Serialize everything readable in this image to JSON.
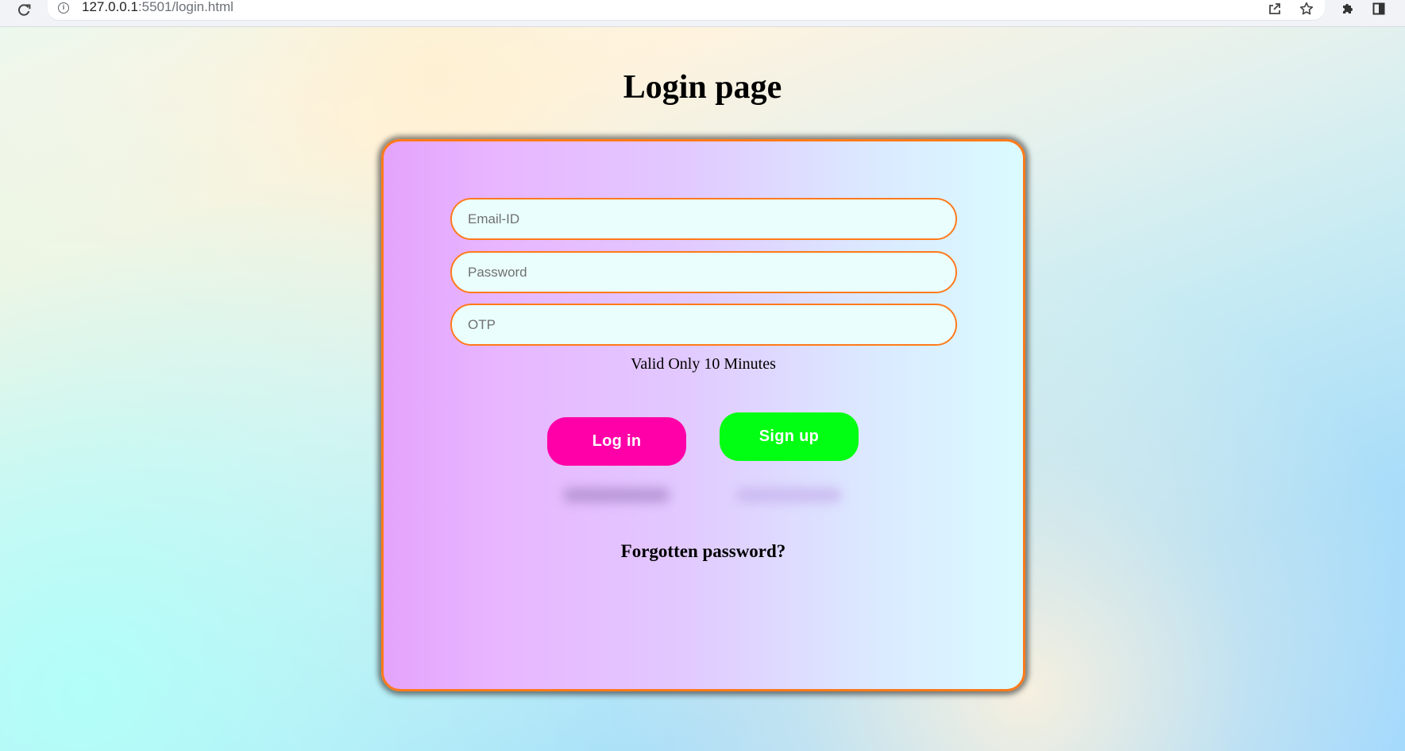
{
  "browser": {
    "url_host": "127.0.0.1",
    "url_rest": ":5501/login.html"
  },
  "page": {
    "title": "Login page"
  },
  "form": {
    "email_placeholder": "Email-ID",
    "password_placeholder": "Password",
    "otp_placeholder": "OTP",
    "otp_note": "Valid Only 10 Minutes",
    "login_label": "Log in",
    "signup_label": "Sign up",
    "forgot_label": "Forgotten password?"
  },
  "icons": {
    "reload": "reload-icon",
    "info": "info-icon",
    "share": "share-icon",
    "star": "star-icon",
    "extensions": "puzzle-icon",
    "sidebar": "sidebar-icon"
  },
  "colors": {
    "accent_border": "#ff7a1a",
    "login_button": "#ff00a8",
    "signup_button": "#00ff12",
    "input_background": "#eafffd"
  }
}
